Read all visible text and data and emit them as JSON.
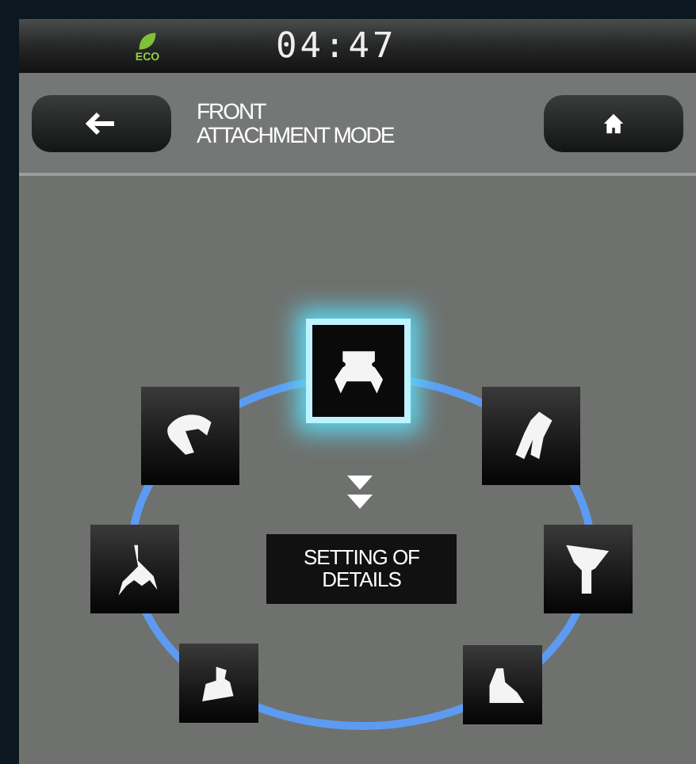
{
  "status_bar": {
    "eco_label": "ECO",
    "time": "04:47"
  },
  "header": {
    "title_lines": [
      "FRONT",
      "ATTACHMENT MODE"
    ]
  },
  "attachments": [
    {
      "selected": true
    },
    {
      "selected": false
    },
    {
      "selected": false
    },
    {
      "selected": false
    },
    {
      "selected": false
    },
    {
      "selected": false
    },
    {
      "selected": false
    }
  ],
  "details_button": {
    "label": "SETTING OF DETAILS"
  }
}
